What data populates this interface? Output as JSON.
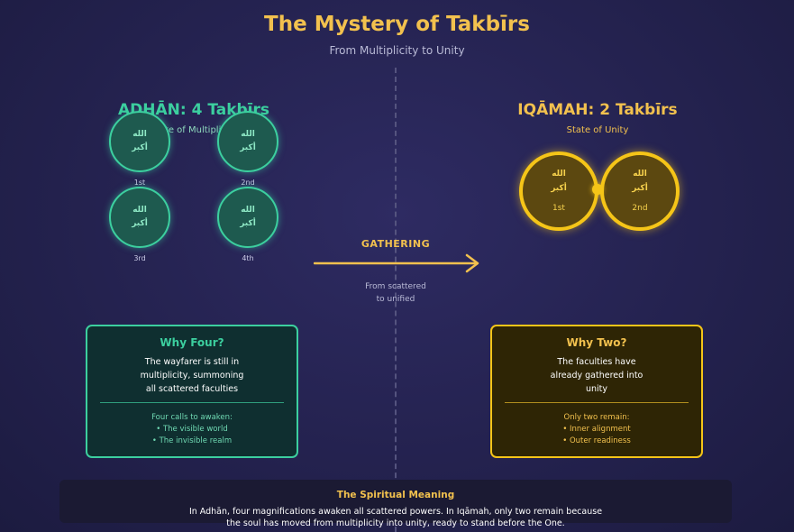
{
  "header": {
    "title": "The Mystery of Takbīrs",
    "subtitle": "From Multiplicity to Unity"
  },
  "left": {
    "title": "ADHĀN: 4 Takbīrs",
    "state": "State of Multiplicity",
    "circles": [
      {
        "line1": "الله",
        "line2": "أكبر",
        "label": "1st"
      },
      {
        "line1": "الله",
        "line2": "أكبر",
        "label": "2nd"
      },
      {
        "line1": "الله",
        "line2": "أكبر",
        "label": "3rd"
      },
      {
        "line1": "الله",
        "line2": "أكبر",
        "label": "4th"
      }
    ]
  },
  "right": {
    "title": "IQĀMAH: 2 Takbīrs",
    "state": "State of Unity",
    "circles": [
      {
        "line1": "الله",
        "line2": "أكبر",
        "label": "1st"
      },
      {
        "line1": "الله",
        "line2": "أكبر",
        "label": "2nd"
      }
    ]
  },
  "center": {
    "label": "GATHERING",
    "caption_line1": "From scattered",
    "caption_line2": "to unified"
  },
  "card_left": {
    "title": "Why Four?",
    "lines": [
      "The wayfarer is still in",
      "multiplicity, summoning",
      "all scattered faculties"
    ],
    "sub_title": "Four calls to awaken:",
    "items": [
      "• The visible world",
      "• The invisible realm"
    ]
  },
  "card_right": {
    "title": "Why Two?",
    "lines": [
      "The faculties have",
      "already gathered into",
      "unity"
    ],
    "sub_title": "Only two remain:",
    "items": [
      "• Inner alignment",
      "• Outer readiness"
    ]
  },
  "meaning": {
    "title": "The Spiritual Meaning",
    "line1": "In Adhān, four magnifications awaken all scattered powers. In Iqāmah, only two remain because",
    "line2": "the soul has moved from multiplicity into unity, ready to stand before the One."
  },
  "colors": {
    "accent_gold": "#f2c14e",
    "accent_green": "#3ccf9f",
    "background": "#24224f"
  }
}
